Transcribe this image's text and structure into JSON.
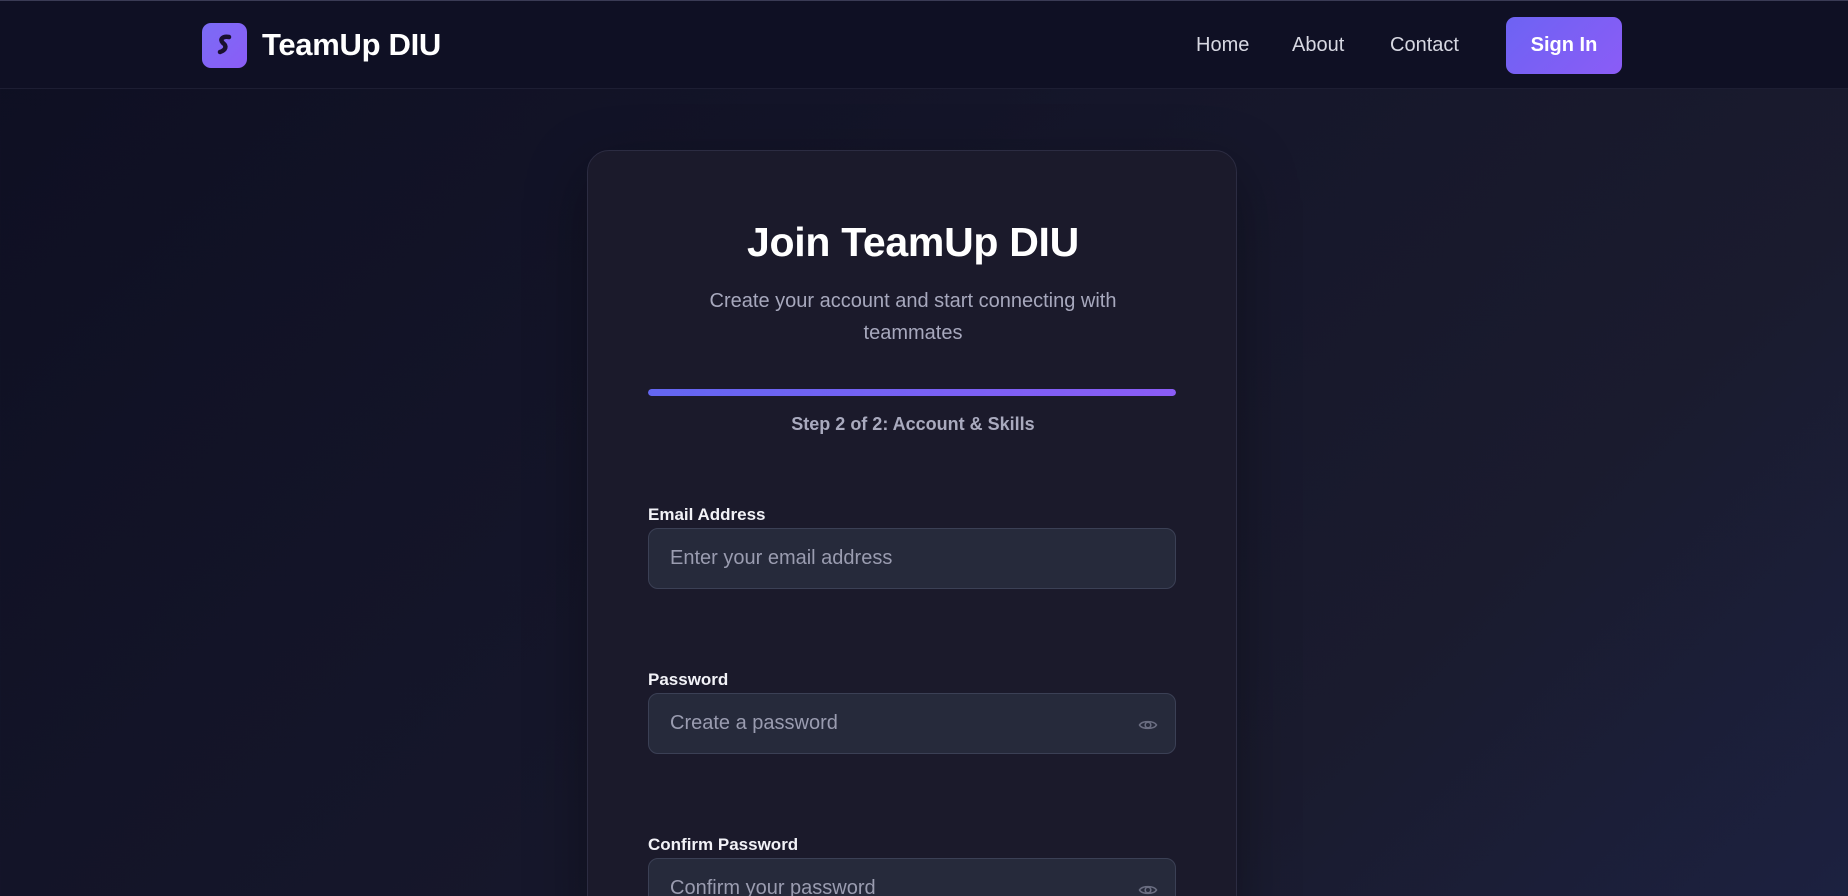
{
  "header": {
    "brand_name": "TeamUp DIU",
    "logo_icon": "s-logo-icon",
    "nav": {
      "home": "Home",
      "about": "About",
      "contact": "Contact"
    },
    "signin_label": "Sign In"
  },
  "card": {
    "title": "Join TeamUp DIU",
    "subtitle": "Create your account and start connecting with teammates",
    "progress": {
      "fraction": 1.0,
      "step_text": "Step 2 of 2: Account & Skills"
    },
    "fields": {
      "email": {
        "label": "Email Address",
        "placeholder": "Enter your email address",
        "value": ""
      },
      "password": {
        "label": "Password",
        "placeholder": "Create a password",
        "value": "",
        "toggle_icon": "eye-icon"
      },
      "confirm": {
        "label": "Confirm Password",
        "placeholder": "Confirm your password",
        "value": "",
        "toggle_icon": "eye-icon"
      }
    }
  },
  "colors": {
    "accent_start": "#6366f1",
    "accent_end": "#8b5cf6",
    "background": "#12132a",
    "card": "#1b1a2b",
    "input": "#262a3b"
  }
}
